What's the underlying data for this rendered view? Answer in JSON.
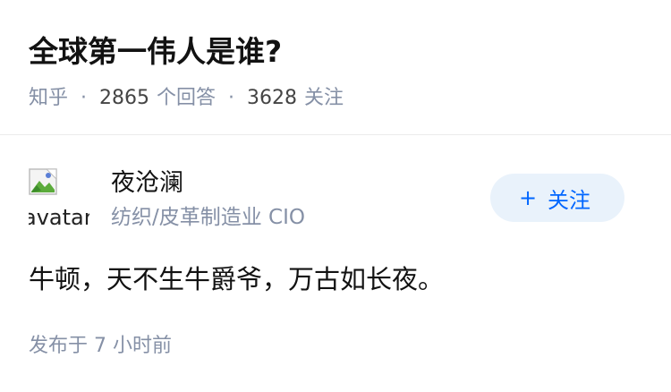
{
  "question": {
    "title": "全球第一伟人是谁?",
    "source": "知乎",
    "separator": "·",
    "answer_count": "2865",
    "answer_label": "个回答",
    "follower_count": "3628",
    "follower_label": "关注"
  },
  "author": {
    "avatar_alt": "avatar",
    "name": "夜沧澜",
    "headline": "纺织/皮革制造业 CIO",
    "follow_icon": "plus-icon",
    "follow_plus": "+",
    "follow_label": "关注"
  },
  "answer": {
    "content": "牛顿，天不生牛爵爷，万古如长夜。",
    "published": "发布于 7 小时前"
  },
  "colors": {
    "meta_gray": "#8590a6",
    "accent_blue": "#0066ff",
    "button_bg": "#e9f2fb",
    "divider": "#ebebeb"
  }
}
